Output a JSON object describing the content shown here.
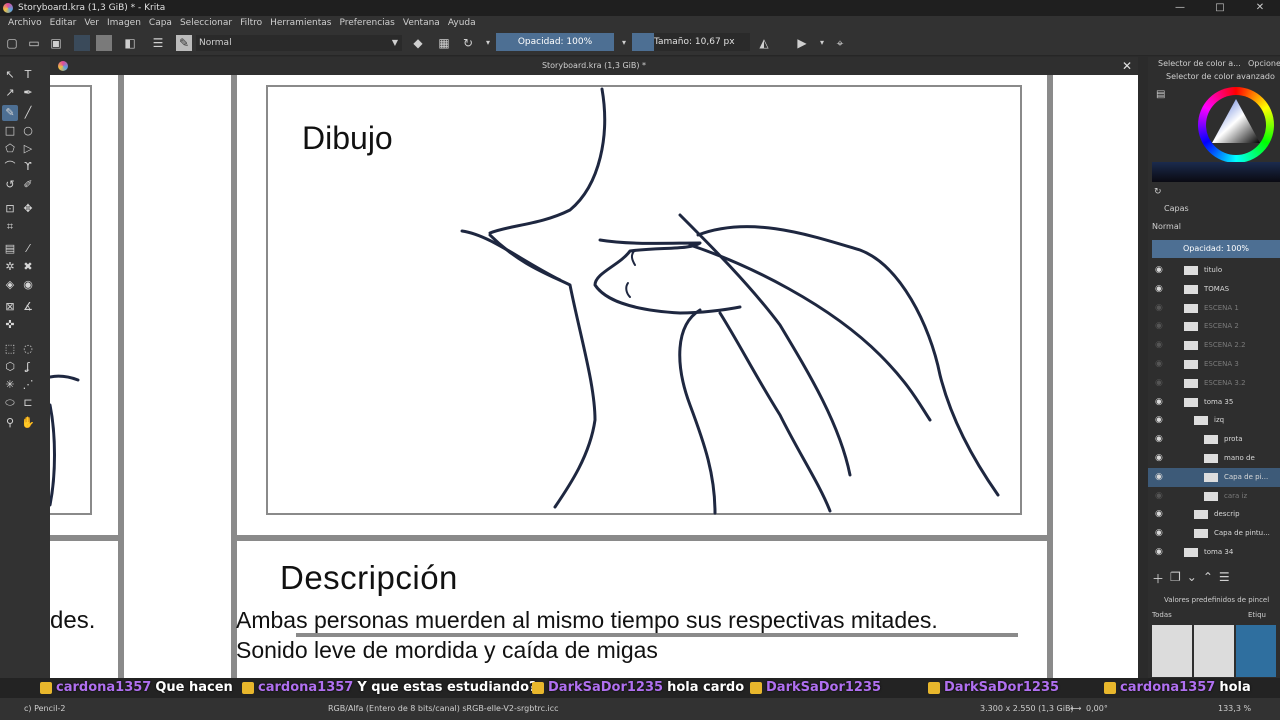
{
  "window": {
    "title": "Storyboard.kra (1,3 GiB) * - Krita",
    "controls": [
      "—",
      "□",
      "✕"
    ]
  },
  "menu": [
    "Archivo",
    "Editar",
    "Ver",
    "Imagen",
    "Capa",
    "Seleccionar",
    "Filtro",
    "Herramientas",
    "Preferencias",
    "Ventana",
    "Ayuda"
  ],
  "toolbar": {
    "blend_mode": "Normal",
    "opacity": "Opacidad: 100%",
    "size": "Tamaño: 10,67 px"
  },
  "document": {
    "tab_title": "Storyboard.kra (1,3 GiB) *",
    "close_label": "✕"
  },
  "canvas_text": {
    "panel_title": "Dibujo",
    "description_title": "Descripción",
    "description_line_1": "Ambas personas muerden al mismo tiempo sus respectivas mitades.",
    "description_line_2": "Sonido leve de mordida y caída de migas",
    "left_partial": "des."
  },
  "right_panel": {
    "tab_color_selector": "Selector de color a...",
    "tab_options": "Opcione",
    "color_selector_title": "Selector de color avanzado",
    "layers_title": "Capas",
    "layers_blend": "Normal",
    "layers_opacity": "Opacidad:  100%",
    "layers": [
      {
        "name": "titulo",
        "visible": true
      },
      {
        "name": "TOMAS",
        "visible": true
      },
      {
        "name": "ESCENA 1",
        "visible": false
      },
      {
        "name": "ESCENA 2",
        "visible": false
      },
      {
        "name": "ESCENA 2.2",
        "visible": false
      },
      {
        "name": "ESCENA 3",
        "visible": false
      },
      {
        "name": "ESCENA 3.2",
        "visible": false
      },
      {
        "name": "toma 35",
        "visible": true
      },
      {
        "name": "izq",
        "visible": true
      },
      {
        "name": "prota",
        "visible": true
      },
      {
        "name": "mano de",
        "visible": true
      },
      {
        "name": "Capa de pi...",
        "visible": true,
        "selected": true
      },
      {
        "name": "cara iz",
        "visible": false
      },
      {
        "name": "descrip",
        "visible": true
      },
      {
        "name": "Capa de pintu...",
        "visible": true
      },
      {
        "name": "toma 34",
        "visible": true
      }
    ],
    "presets_title": "Valores predefinidos de pincel",
    "presets_filter": "Todas",
    "presets_tag": "Etiqu"
  },
  "chat": [
    {
      "user": "cardona1357",
      "message": "Que hacen"
    },
    {
      "user": "cardona1357",
      "message": "Y que estas estudiando?"
    },
    {
      "user": "DarkSaDor1235",
      "message": "hola cardo"
    },
    {
      "user": "DarkSaDor1235",
      "message": ""
    },
    {
      "user": "DarkSaDor1235",
      "message": ""
    },
    {
      "user": "cardona1357",
      "message": "hola"
    }
  ],
  "status": {
    "brush": "c) Pencil-2",
    "color_profile": "RGB/Alfa (Entero de 8 bits/canal)  sRGB-elle-V2-srgbtrc.icc",
    "dimensions": "3.300 x 2.550 (1,3 GiB)",
    "rotation": "0,00°",
    "zoom": "133,3 %"
  }
}
